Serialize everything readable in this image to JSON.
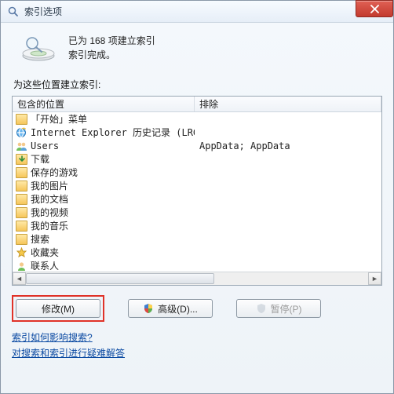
{
  "window": {
    "title": "索引选项",
    "close_label": "X"
  },
  "status": {
    "line1": "已为 168 项建立索引",
    "line2": "索引完成。"
  },
  "group_label": "为这些位置建立索引:",
  "columns": {
    "include": "包含的位置",
    "exclude": "排除"
  },
  "rows": [
    {
      "icon": "folder",
      "name": "「开始」菜单",
      "exclude": ""
    },
    {
      "icon": "ie",
      "name": "Internet Explorer 历史记录 (LRG...",
      "exclude": ""
    },
    {
      "icon": "group",
      "name": "Users",
      "exclude": "AppData; AppData"
    },
    {
      "icon": "dl",
      "name": "下载",
      "exclude": ""
    },
    {
      "icon": "game",
      "name": "保存的游戏",
      "exclude": ""
    },
    {
      "icon": "pic",
      "name": "我的图片",
      "exclude": ""
    },
    {
      "icon": "doc",
      "name": "我的文档",
      "exclude": ""
    },
    {
      "icon": "vid",
      "name": "我的视频",
      "exclude": ""
    },
    {
      "icon": "mus",
      "name": "我的音乐",
      "exclude": ""
    },
    {
      "icon": "search",
      "name": "搜索",
      "exclude": ""
    },
    {
      "icon": "fav",
      "name": "收藏夹",
      "exclude": ""
    },
    {
      "icon": "contact",
      "name": "联系人",
      "exclude": ""
    }
  ],
  "buttons": {
    "modify": "修改(M)",
    "advanced": "高级(D)...",
    "pause": "暂停(P)"
  },
  "links": {
    "how_affects": "索引如何影响搜索?",
    "troubleshoot": "对搜索和索引进行疑难解答"
  },
  "icons": {
    "search_glass": "🔍"
  }
}
